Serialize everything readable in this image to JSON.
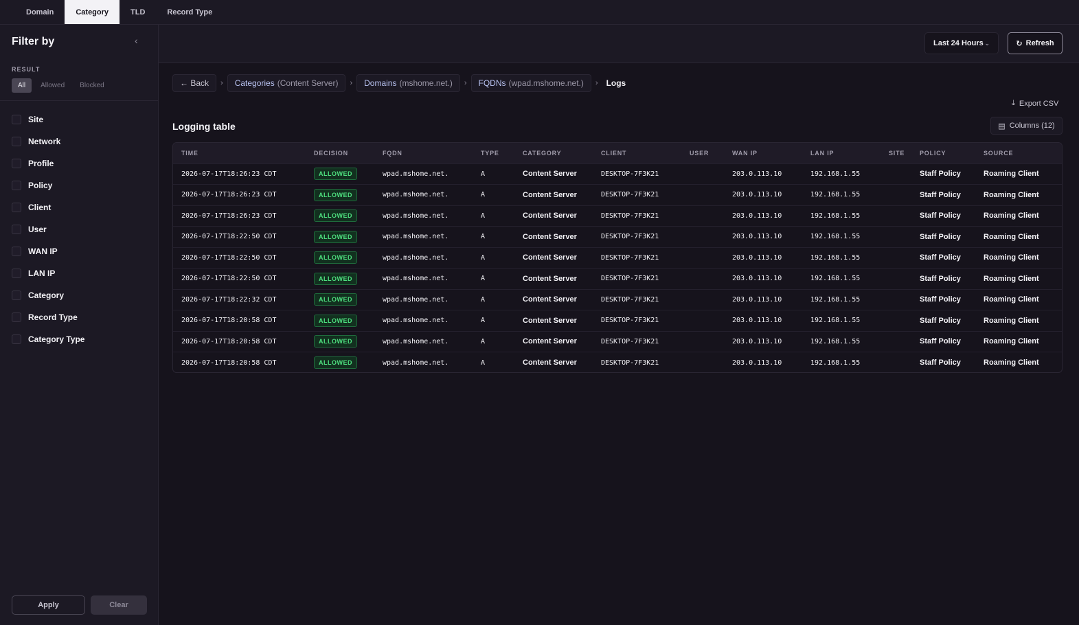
{
  "tabs": [
    {
      "label": "Domain",
      "active": false
    },
    {
      "label": "Category",
      "active": true
    },
    {
      "label": "TLD",
      "active": false
    },
    {
      "label": "Record Type",
      "active": false
    }
  ],
  "sidebar": {
    "title": "Filter by",
    "collapse_icon": "chevron-left-icon",
    "result_label": "RESULT",
    "result_options": [
      "All",
      "Allowed",
      "Blocked"
    ],
    "result_selected": "All",
    "filters": [
      "Site",
      "Network",
      "Profile",
      "Policy",
      "Client",
      "User",
      "WAN IP",
      "LAN IP",
      "Category",
      "Record Type",
      "Category Type"
    ],
    "apply_label": "Apply",
    "clear_label": "Clear"
  },
  "header": {
    "time_range": "Last 24 Hours",
    "refresh_label": "Refresh"
  },
  "breadcrumb": {
    "back_label": "Back",
    "items": [
      {
        "label": "Categories",
        "sub": "(Content Server)"
      },
      {
        "label": "Domains",
        "sub": "(mshome.net.)"
      },
      {
        "label": "FQDNs",
        "sub": "(wpad.mshome.net.)"
      }
    ],
    "current": "Logs"
  },
  "toolbar": {
    "export_label": "Export CSV",
    "columns_label": "Columns (12)"
  },
  "table": {
    "title": "Logging table",
    "columns": [
      "TIME",
      "DECISION",
      "FQDN",
      "TYPE",
      "CATEGORY",
      "CLIENT",
      "USER",
      "WAN IP",
      "LAN IP",
      "SITE",
      "POLICY",
      "SOURCE"
    ],
    "rows": [
      [
        "2026-07-17T18:26:23 CDT",
        "ALLOWED",
        "wpad.mshome.net.",
        "A",
        "Content Server",
        "DESKTOP-7F3K21",
        "",
        "203.0.113.10",
        "192.168.1.55",
        "",
        "Staff Policy",
        "Roaming Client"
      ],
      [
        "2026-07-17T18:26:23 CDT",
        "ALLOWED",
        "wpad.mshome.net.",
        "A",
        "Content Server",
        "DESKTOP-7F3K21",
        "",
        "203.0.113.10",
        "192.168.1.55",
        "",
        "Staff Policy",
        "Roaming Client"
      ],
      [
        "2026-07-17T18:26:23 CDT",
        "ALLOWED",
        "wpad.mshome.net.",
        "A",
        "Content Server",
        "DESKTOP-7F3K21",
        "",
        "203.0.113.10",
        "192.168.1.55",
        "",
        "Staff Policy",
        "Roaming Client"
      ],
      [
        "2026-07-17T18:22:50 CDT",
        "ALLOWED",
        "wpad.mshome.net.",
        "A",
        "Content Server",
        "DESKTOP-7F3K21",
        "",
        "203.0.113.10",
        "192.168.1.55",
        "",
        "Staff Policy",
        "Roaming Client"
      ],
      [
        "2026-07-17T18:22:50 CDT",
        "ALLOWED",
        "wpad.mshome.net.",
        "A",
        "Content Server",
        "DESKTOP-7F3K21",
        "",
        "203.0.113.10",
        "192.168.1.55",
        "",
        "Staff Policy",
        "Roaming Client"
      ],
      [
        "2026-07-17T18:22:50 CDT",
        "ALLOWED",
        "wpad.mshome.net.",
        "A",
        "Content Server",
        "DESKTOP-7F3K21",
        "",
        "203.0.113.10",
        "192.168.1.55",
        "",
        "Staff Policy",
        "Roaming Client"
      ],
      [
        "2026-07-17T18:22:32 CDT",
        "ALLOWED",
        "wpad.mshome.net.",
        "A",
        "Content Server",
        "DESKTOP-7F3K21",
        "",
        "203.0.113.10",
        "192.168.1.55",
        "",
        "Staff Policy",
        "Roaming Client"
      ],
      [
        "2026-07-17T18:20:58 CDT",
        "ALLOWED",
        "wpad.mshome.net.",
        "A",
        "Content Server",
        "DESKTOP-7F3K21",
        "",
        "203.0.113.10",
        "192.168.1.55",
        "",
        "Staff Policy",
        "Roaming Client"
      ],
      [
        "2026-07-17T18:20:58 CDT",
        "ALLOWED",
        "wpad.mshome.net.",
        "A",
        "Content Server",
        "DESKTOP-7F3K21",
        "",
        "203.0.113.10",
        "192.168.1.55",
        "",
        "Staff Policy",
        "Roaming Client"
      ],
      [
        "2026-07-17T18:20:58 CDT",
        "ALLOWED",
        "wpad.mshome.net.",
        "A",
        "Content Server",
        "DESKTOP-7F3K21",
        "",
        "203.0.113.10",
        "192.168.1.55",
        "",
        "Staff Policy",
        "Roaming Client"
      ]
    ]
  },
  "colors": {
    "background": "#16131c",
    "panel": "#1c1924",
    "allowed_text": "#4ee07f",
    "allowed_bg": "#12301f",
    "link": "#b9c3f2"
  }
}
